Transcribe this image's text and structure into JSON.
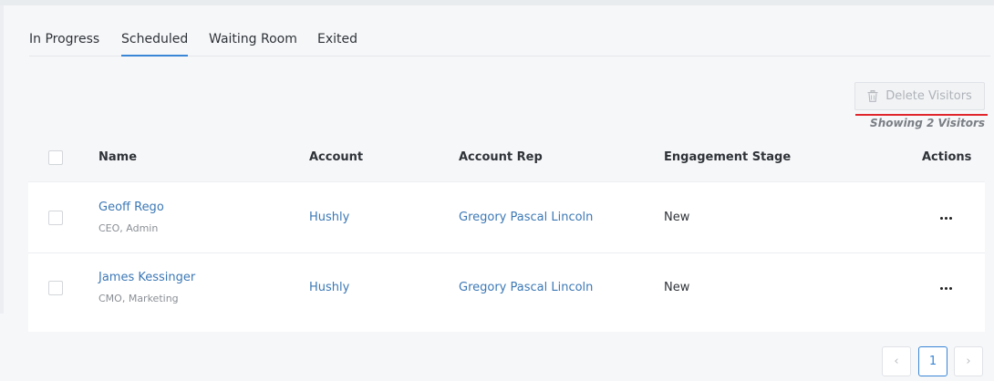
{
  "tabs": [
    {
      "label": "In Progress",
      "active": false
    },
    {
      "label": "Scheduled",
      "active": true
    },
    {
      "label": "Waiting Room",
      "active": false
    },
    {
      "label": "Exited",
      "active": false
    }
  ],
  "toolbar": {
    "delete_label": "Delete Visitors",
    "delete_icon": "trash-icon",
    "showing_text": "Showing 2 Visitors"
  },
  "table": {
    "columns": [
      "Name",
      "Account",
      "Account Rep",
      "Engagement Stage",
      "Actions"
    ],
    "rows": [
      {
        "name": "Geoff Rego",
        "title": "CEO, Admin",
        "account": "Hushly",
        "rep": "Gregory Pascal Lincoln",
        "stage": "New"
      },
      {
        "name": "James Kessinger",
        "title": "CMO, Marketing",
        "account": "Hushly",
        "rep": "Gregory Pascal Lincoln",
        "stage": "New"
      }
    ]
  },
  "pagination": {
    "prev": "‹",
    "current": "1",
    "next": "›"
  },
  "colors": {
    "accent": "#3a86d6",
    "link": "#3c78b5",
    "highlight": "#e0262c"
  }
}
